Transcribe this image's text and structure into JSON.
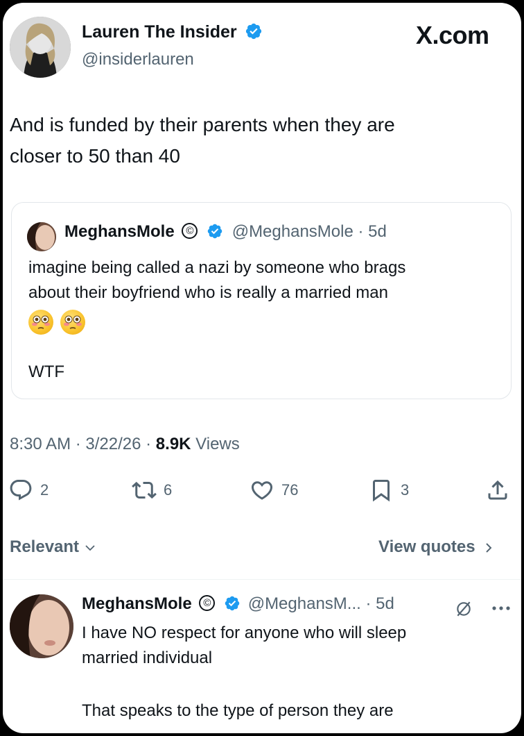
{
  "tweet": {
    "author_name": "Lauren The Insider",
    "handle": "@insiderlauren",
    "site_label": "X.com",
    "text_line1": "And is funded by their parents when they are",
    "text_line2": "closer to 50 than 40",
    "timestamp": "8:30 AM · 3/22/26 · ",
    "views_count": "8.9K",
    "views_label": " Views"
  },
  "quoted": {
    "author_name": "MeghansMole",
    "copyright": "©",
    "handle_time": "@MeghansMole · 5d",
    "text_line1": "imagine being called a nazi by someone who brags",
    "text_line2": "about their boyfriend who is really a married man",
    "text_extra": "WTF"
  },
  "actions": {
    "replies": "2",
    "reposts": "6",
    "likes": "76",
    "bookmarks": "3"
  },
  "sort": {
    "relevant_label": "Relevant",
    "view_quotes_label": "View quotes"
  },
  "reply": {
    "author_name": "MeghansMole",
    "copyright": "©",
    "handle_time": "@MeghansM... · 5d",
    "text_line1": "I have NO respect for anyone who will sleep",
    "text_line2": "married individual",
    "text_line3": "That speaks to the type of person they are"
  },
  "colors": {
    "verified": "#1d9bf0",
    "text": "#0f1419",
    "secondary": "#536471"
  }
}
